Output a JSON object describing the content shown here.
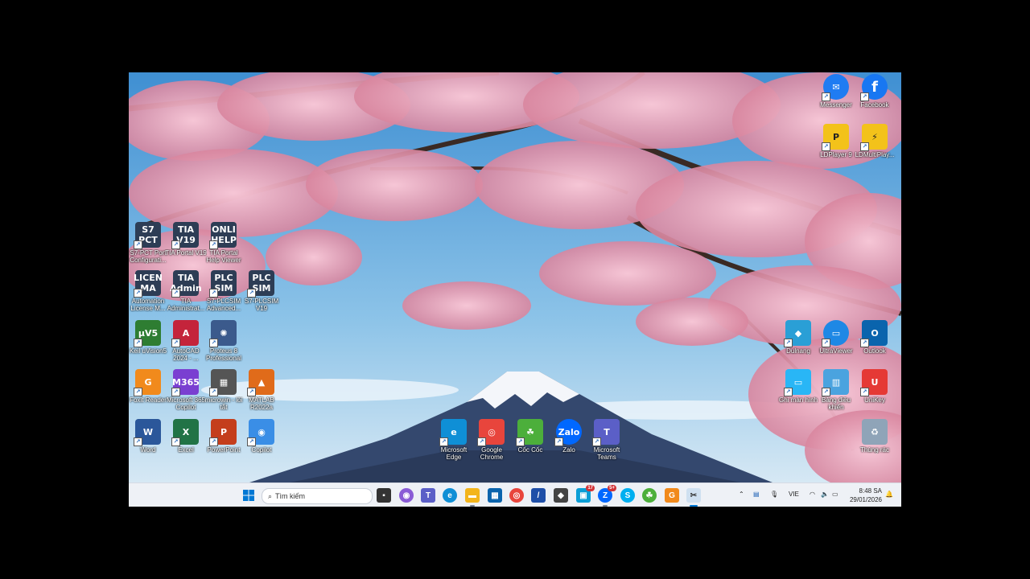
{
  "desktop": {
    "left_icons": [
      {
        "name": "s7-pct-icon",
        "label": "S7-PCT Port Configurati...",
        "glyph": "S7\nPCT",
        "bg": "#2d3d55"
      },
      {
        "name": "tia-portal-v19-icon",
        "label": "TIA Portal V19",
        "glyph": "TIA\nV19",
        "bg": "#2d3d55"
      },
      {
        "name": "tia-portal-help-icon",
        "label": "TIA Portal Help Viewer",
        "glyph": "ONLI\nHELP",
        "bg": "#2d3d55"
      },
      {
        "name": "automation-license-icon",
        "label": "Automation License M...",
        "glyph": "LICEN\nMA",
        "bg": "#2d3d55"
      },
      {
        "name": "tia-administrator-icon",
        "label": "TIA Administrat...",
        "glyph": "TIA\nAdmin",
        "bg": "#2d3d55"
      },
      {
        "name": "s7-plcsim-advanced-icon",
        "label": "S7-PLCSIM Advanced...",
        "glyph": "PLC\nSIM",
        "bg": "#2d3d55"
      },
      {
        "name": "s7-plcsim-v19-icon",
        "label": "S7-PLCSIM V19",
        "glyph": "PLC\nSIM",
        "bg": "#2d3d55"
      },
      {
        "name": "keil-uvision5-icon",
        "label": "Keil uVision5",
        "glyph": "µV5",
        "bg": "#2e7d32"
      },
      {
        "name": "autocad-icon",
        "label": "AutoCAD 2024 - ...",
        "glyph": "A",
        "bg": "#c4243b"
      },
      {
        "name": "proteus-icon",
        "label": "Proteus 8 Professional",
        "glyph": "✺",
        "bg": "#3b5a8c"
      },
      {
        "name": "foxit-reader-icon",
        "label": "Foxit Reader",
        "glyph": "G",
        "bg": "#f18a1c"
      },
      {
        "name": "microsoft-365-copilot-icon",
        "label": "Microsoft 365 Copilot",
        "glyph": "M365",
        "bg": "#7a3fd1"
      },
      {
        "name": "microwin-icon",
        "label": "microwin - lối tắt",
        "glyph": "▦",
        "bg": "#555"
      },
      {
        "name": "matlab-icon",
        "label": "MATLAB R2022a",
        "glyph": "▲",
        "bg": "#e06b1a"
      },
      {
        "name": "word-icon",
        "label": "Word",
        "glyph": "W",
        "bg": "#2b579a"
      },
      {
        "name": "excel-icon",
        "label": "Excel",
        "glyph": "X",
        "bg": "#217346"
      },
      {
        "name": "powerpoint-icon",
        "label": "PowerPoint",
        "glyph": "P",
        "bg": "#c43e1c"
      },
      {
        "name": "copilot-icon",
        "label": "Copilot",
        "glyph": "◉",
        "bg": "#3a8ee6"
      }
    ],
    "center_icons": [
      {
        "name": "microsoft-edge-icon",
        "label": "Microsoft Edge",
        "glyph": "e",
        "bg": "#0f8fd6"
      },
      {
        "name": "google-chrome-icon",
        "label": "Google Chrome",
        "glyph": "◎",
        "bg": "#e8453c"
      },
      {
        "name": "coc-coc-icon",
        "label": "Cốc Cốc",
        "glyph": "☘",
        "bg": "#4caf3b"
      },
      {
        "name": "zalo-icon",
        "label": "Zalo",
        "glyph": "Zalo",
        "bg": "#0068ff"
      },
      {
        "name": "microsoft-teams-icon",
        "label": "Microsoft Teams",
        "glyph": "T",
        "bg": "#5b5fc7"
      }
    ],
    "right_icons": [
      {
        "name": "messenger-icon",
        "label": "Messenger",
        "glyph": "✉",
        "bg": "#1f7cf2"
      },
      {
        "name": "facebook-icon",
        "label": "Facebook",
        "glyph": "f",
        "bg": "#1877f2"
      },
      {
        "name": "ldplayer-icon",
        "label": "LDPlayer 9",
        "glyph": "P",
        "bg": "#f3c21a"
      },
      {
        "name": "ldmultiplayer-icon",
        "label": "LDMultiPlay...",
        "glyph": "⚡",
        "bg": "#f3c21a"
      },
      {
        "name": "unknown-blue-icon",
        "label": "Dulnang",
        "glyph": "◆",
        "bg": "#2a9fd6"
      },
      {
        "name": "ultraviewer-icon",
        "label": "UltraViewer",
        "glyph": "▭",
        "bg": "#1e88e5"
      },
      {
        "name": "outlook-icon",
        "label": "Outlook",
        "glyph": "O",
        "bg": "#0a64ad"
      },
      {
        "name": "screen-recorder-icon",
        "label": "Ghi màn hình",
        "glyph": "▭",
        "bg": "#29b6f6"
      },
      {
        "name": "bang-dieu-khien-icon",
        "label": "Bảng điều khiển",
        "glyph": "▥",
        "bg": "#4aa3df"
      },
      {
        "name": "unikey-icon",
        "label": "UniKey",
        "glyph": "U",
        "bg": "#e53935"
      },
      {
        "name": "recycle-bin-icon",
        "label": "Thùng rác",
        "glyph": "♻",
        "bg": "#8fa4b8"
      }
    ]
  },
  "taskbar": {
    "search_placeholder": "Tìm kiếm",
    "language": "VIE",
    "time": "8:48 SA",
    "date": "29/01/2026",
    "teams_badge": "17",
    "zalo_badge": "5+"
  }
}
